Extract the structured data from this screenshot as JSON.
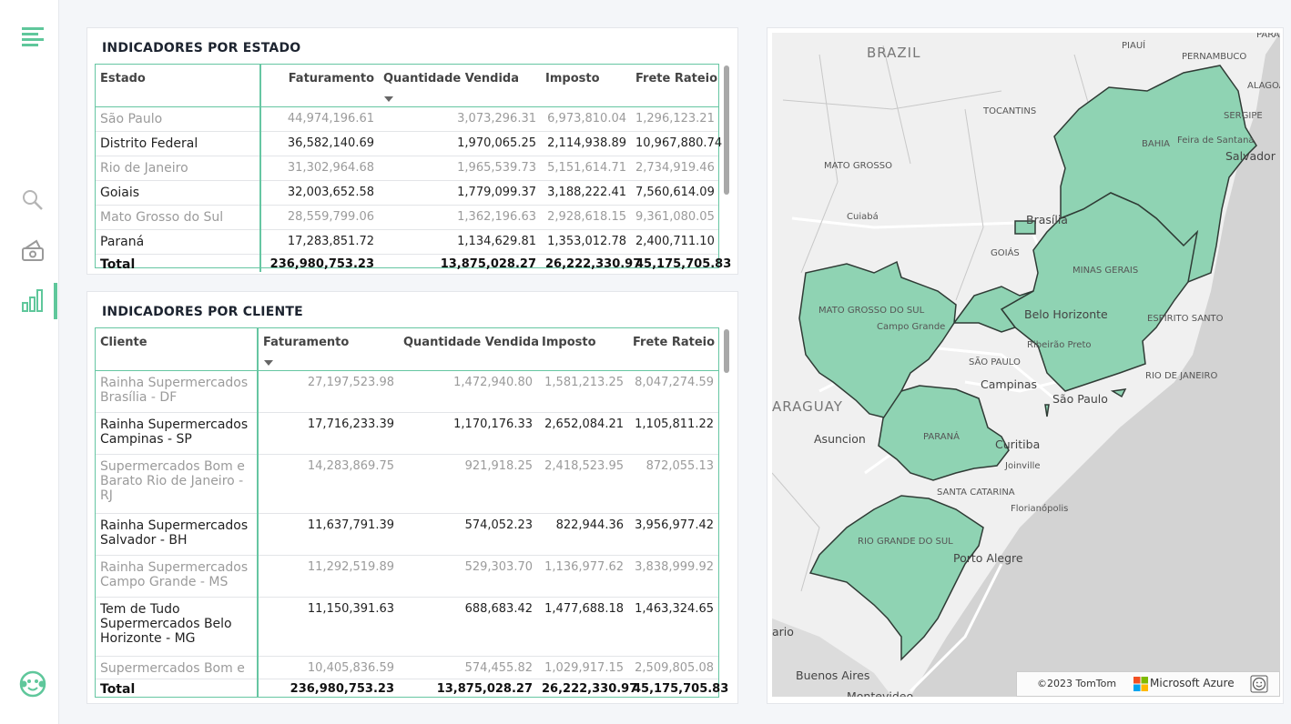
{
  "sidebar": {
    "icons": [
      "menu-icon",
      "search-icon",
      "money-icon",
      "chart-bar-icon",
      "avatar-icon"
    ]
  },
  "estado_table": {
    "title": "INDICADORES POR ESTADO",
    "headers": [
      "Estado",
      "Faturamento",
      "Quantidade Vendida",
      "Imposto",
      "Frete Rateio"
    ],
    "rows": [
      [
        "São Paulo",
        "44,974,196.61",
        "3,073,296.31",
        "6,973,810.04",
        "1,296,123.21"
      ],
      [
        "Distrito Federal",
        "36,582,140.69",
        "1,970,065.25",
        "2,114,938.89",
        "10,967,880.74"
      ],
      [
        "Rio de Janeiro",
        "31,302,964.68",
        "1,965,539.73",
        "5,151,614.71",
        "2,734,919.46"
      ],
      [
        "Goiais",
        "32,003,652.58",
        "1,779,099.37",
        "3,188,222.41",
        "7,560,614.09"
      ],
      [
        "Mato Grosso do Sul",
        "28,559,799.06",
        "1,362,196.63",
        "2,928,618.15",
        "9,361,080.05"
      ],
      [
        "Paraná",
        "17,283,851.72",
        "1,134,629.81",
        "1,353,012.78",
        "2,400,711.10"
      ]
    ],
    "total": [
      "Total",
      "236,980,753.23",
      "13,875,028.27",
      "26,222,330.97",
      "45,175,705.83"
    ]
  },
  "cliente_table": {
    "title": "INDICADORES POR CLIENTE",
    "headers": [
      "Cliente",
      "Faturamento",
      "Quantidade Vendida",
      "Imposto",
      "Frete Rateio"
    ],
    "rows": [
      [
        "Rainha Supermercados Brasília - DF",
        "27,197,523.98",
        "1,472,940.80",
        "1,581,213.25",
        "8,047,274.59"
      ],
      [
        "Rainha Supermercados Campinas - SP",
        "17,716,233.39",
        "1,170,176.33",
        "2,652,084.21",
        "1,105,811.22"
      ],
      [
        "Supermercados Bom e Barato Rio de Janeiro - RJ",
        "14,283,869.75",
        "921,918.25",
        "2,418,523.95",
        "872,055.13"
      ],
      [
        "Rainha Supermercados Salvador - BH",
        "11,637,791.39",
        "574,052.23",
        "822,944.36",
        "3,956,977.42"
      ],
      [
        "Rainha Supermercados Campo Grande - MS",
        "11,292,519.89",
        "529,303.70",
        "1,136,977.62",
        "3,838,999.92"
      ],
      [
        "Tem de Tudo Supermercados Belo Horizonte - MG",
        "11,150,391.63",
        "688,683.42",
        "1,477,688.18",
        "1,463,324.65"
      ],
      [
        "Supermercados Bom e",
        "10,405,836.59",
        "574,455.82",
        "1,029,917.15",
        "2,509,805.08"
      ]
    ],
    "total": [
      "Total",
      "236,980,753.23",
      "13,875,028.27",
      "26,222,330.97",
      "45,175,705.83"
    ]
  },
  "map": {
    "fill_color": "#8fd3b3",
    "labels": {
      "brazil": "BRAZIL",
      "piaui": "PIAUÍ",
      "pernambuco": "PERNAMBUCO",
      "para": "PARÁ",
      "alagoas": "ALAGOA",
      "tocantins": "TOCANTINS",
      "sergipe": "SERGIPE",
      "bahia": "BAHIA",
      "feira": "Feira de Santana",
      "salvador": "Salvador",
      "mato_grosso": "MATO GROSSO",
      "cuiaba": "Cuiabá",
      "brasilia": "Brasília",
      "goias": "GOIÁS",
      "minas": "MINAS GERAIS",
      "mato_grosso_sul": "MATO GROSSO DO SUL",
      "campo_grande": "Campo Grande",
      "belo_horizonte": "Belo Horizonte",
      "espirito_santo": "ESPÍRITO SANTO",
      "ribeirao": "Ribeirão Preto",
      "sao_paulo_state": "SÃO PAULO",
      "rio_state": "RIO DE JANEIRO",
      "paraguay": "ARAGUAY",
      "campinas": "Campinas",
      "sao_paulo_city": "São Paulo",
      "asuncion": "Asuncion",
      "parana": "PARANÁ",
      "curitiba": "Curitiba",
      "joinville": "Joinville",
      "santa_catarina": "SANTA CATARINA",
      "florianopolis": "Florianópolis",
      "rio_grande": "RIO GRANDE DO SUL",
      "porto_alegre": "Porto Alegre",
      "rosario": "ario",
      "buenos_aires": "Buenos Aires",
      "montevideo": "Montevideo"
    },
    "attribution": {
      "tomtom": "©2023 TomTom",
      "azure": "Microsoft Azure",
      "feedback_icon": "smiley-icon"
    }
  }
}
